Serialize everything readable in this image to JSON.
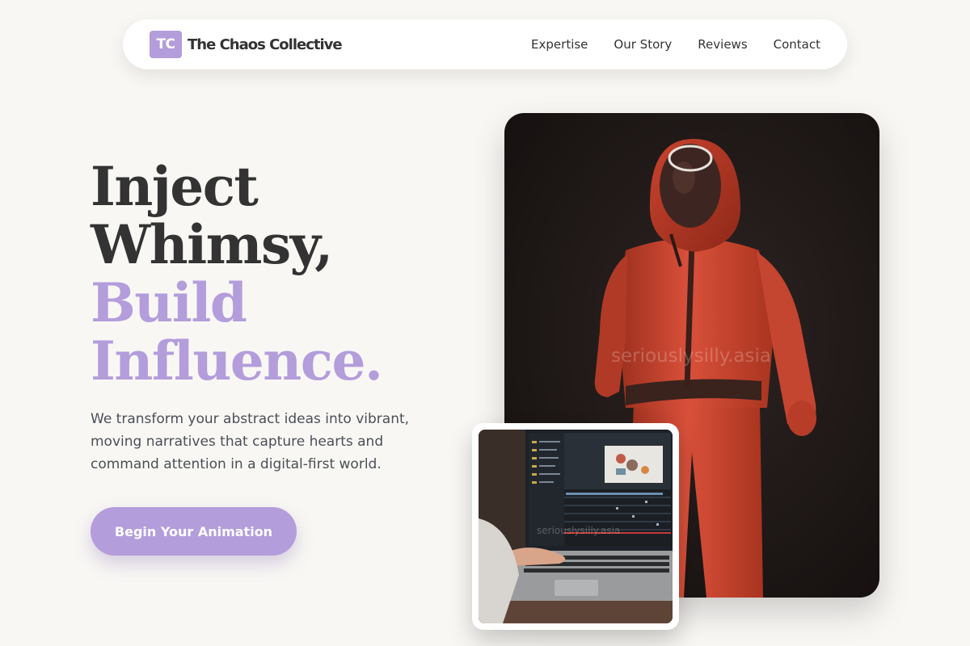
{
  "brand": {
    "mark": "TC",
    "name": "The Chaos Collective"
  },
  "nav": {
    "links": [
      {
        "label": "Expertise"
      },
      {
        "label": "Our Story"
      },
      {
        "label": "Reviews"
      },
      {
        "label": "Contact"
      }
    ]
  },
  "hero": {
    "headline": {
      "line1": "Inject",
      "line2": "Whimsy,",
      "line3": "Build",
      "line4": "Influence."
    },
    "subtext": "We transform your abstract ideas into vibrant, moving narratives that capture hearts and command attention in a digital-first world.",
    "cta_label": "Begin Your Animation"
  },
  "images": {
    "main_watermark": "seriouslysilly.asia",
    "inset_watermark": "seriouslysilly.asia"
  },
  "colors": {
    "accent": "#b39ddb",
    "text_dark": "#333333",
    "text_body": "#4a4f57",
    "background": "#f9f7f4"
  }
}
